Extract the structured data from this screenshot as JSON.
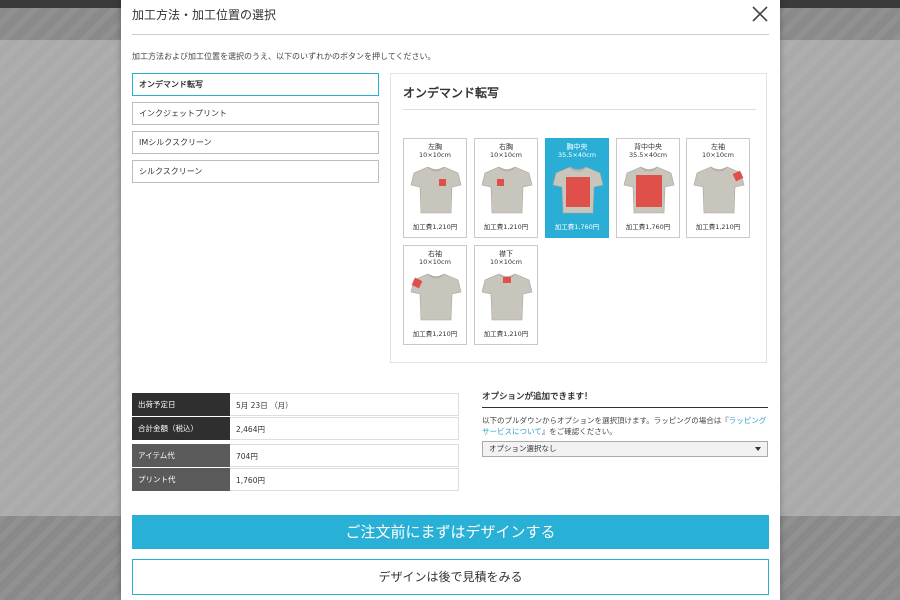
{
  "modal": {
    "title": "加工方法・加工位置の選択",
    "instruction": "加工方法および加工位置を選択のうえ、以下のいずれかのボタンを押してください。"
  },
  "methods": [
    {
      "label": "オンデマンド転写",
      "active": true
    },
    {
      "label": "インクジェットプリント",
      "active": false
    },
    {
      "label": "IMシルクスクリーン",
      "active": false
    },
    {
      "label": "シルクスクリーン",
      "active": false
    }
  ],
  "panel": {
    "title": "オンデマンド転写",
    "positions": [
      {
        "name": "左胸",
        "size": "10×10cm",
        "price": "加工費1,210円",
        "selected": false,
        "print_area": "left-chest"
      },
      {
        "name": "右胸",
        "size": "10×10cm",
        "price": "加工費1,210円",
        "selected": false,
        "print_area": "right-chest"
      },
      {
        "name": "胸中央",
        "size": "35.5×40cm",
        "price": "加工費1,760円",
        "selected": true,
        "print_area": "front-center"
      },
      {
        "name": "背中中央",
        "size": "35.5×40cm",
        "price": "加工費1,760円",
        "selected": false,
        "print_area": "back-center"
      },
      {
        "name": "左袖",
        "size": "10×10cm",
        "price": "加工費1,210円",
        "selected": false,
        "print_area": "left-sleeve"
      },
      {
        "name": "右袖",
        "size": "10×10cm",
        "price": "加工費1,210円",
        "selected": false,
        "print_area": "right-sleeve"
      },
      {
        "name": "襟下",
        "size": "10×10cm",
        "price": "加工費1,210円",
        "selected": false,
        "print_area": "below-collar"
      }
    ]
  },
  "summary": [
    {
      "label": "出荷予定日",
      "value": "5月 23日 （月）",
      "sub": false
    },
    {
      "label": "合計金額（税込）",
      "value": "2,464円",
      "sub": false
    },
    {
      "label": "アイテム代",
      "value": "704円",
      "sub": true
    },
    {
      "label": "プリント代",
      "value": "1,760円",
      "sub": true
    }
  ],
  "options": {
    "title": "オプションが追加できます！",
    "desc_before": "以下のプルダウンからオプションを選択頂けます。ラッピングの場合は『",
    "desc_link": "ラッピングサービスについて",
    "desc_after": "』をご確認ください。",
    "selected": "オプション選択なし"
  },
  "buttons": {
    "primary": "ご注文前にまずはデザインする",
    "secondary": "デザインは後で見積をみる"
  },
  "colors": {
    "accent": "#29b0d6",
    "shirt": "#c8c5bd",
    "print_area": "#e0504a"
  }
}
